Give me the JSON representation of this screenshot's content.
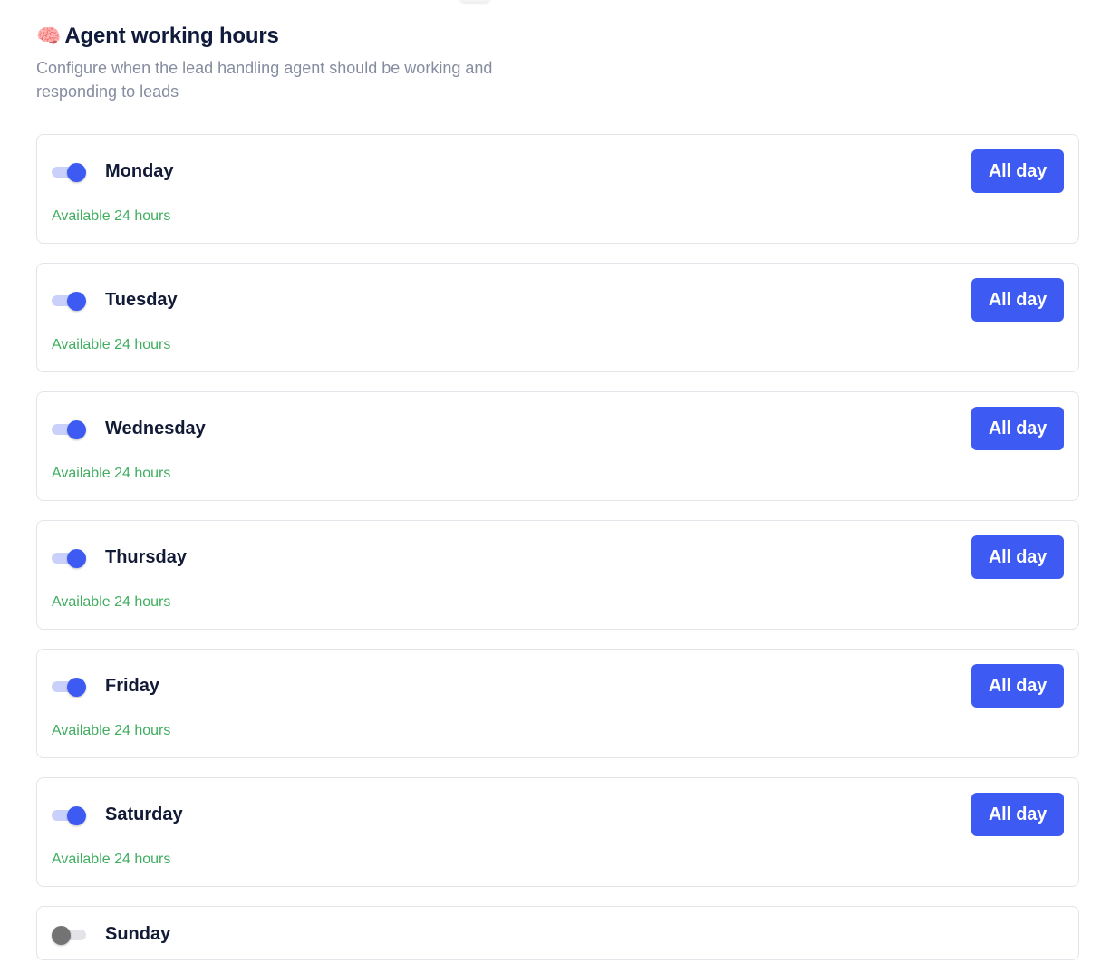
{
  "header": {
    "icon": "brain-icon",
    "icon_glyph": "🧠",
    "title": "Agent working hours",
    "subtitle": "Configure when the lead handling agent should be working and responding to leads"
  },
  "colors": {
    "accent": "#3d5bf2",
    "available": "#3fae5f",
    "toggle_off": "#737373"
  },
  "days": [
    {
      "name": "Monday",
      "enabled": true,
      "button_label": "All day",
      "status": "Available 24 hours"
    },
    {
      "name": "Tuesday",
      "enabled": true,
      "button_label": "All day",
      "status": "Available 24 hours"
    },
    {
      "name": "Wednesday",
      "enabled": true,
      "button_label": "All day",
      "status": "Available 24 hours"
    },
    {
      "name": "Thursday",
      "enabled": true,
      "button_label": "All day",
      "status": "Available 24 hours"
    },
    {
      "name": "Friday",
      "enabled": true,
      "button_label": "All day",
      "status": "Available 24 hours"
    },
    {
      "name": "Saturday",
      "enabled": true,
      "button_label": "All day",
      "status": "Available 24 hours"
    },
    {
      "name": "Sunday",
      "enabled": false
    }
  ]
}
